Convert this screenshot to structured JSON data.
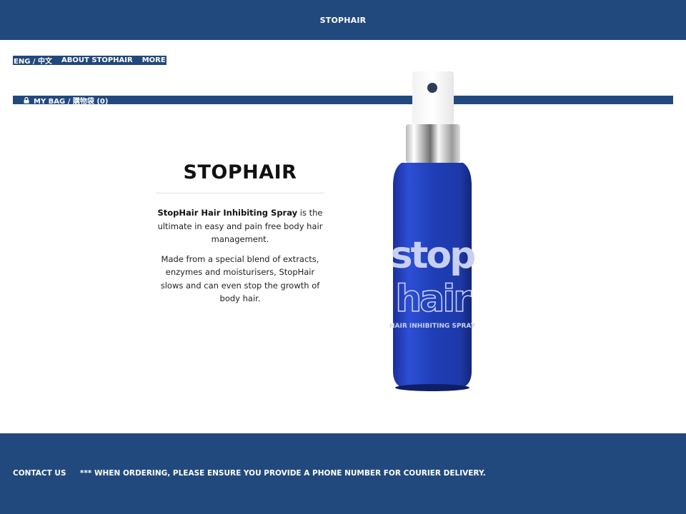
{
  "header": {
    "brand": "STOPHAIR"
  },
  "nav": {
    "language": "ENG / 中文",
    "about": "ABOUT STOPHAIR",
    "more": "MORE"
  },
  "bag": {
    "label": "MY BAG / 購物袋 (0)"
  },
  "product": {
    "title": "STOPHAIR",
    "desc1_bold": "StopHair Hair Inhibiting Spray",
    "desc1_rest": " is the ultimate in easy and pain free body hair management.",
    "desc2": "Made from a special blend of extracts, enzymes and moisturisers, StopHair slows and can even stop the growth of body hair.",
    "bottle_text_line1": "stop",
    "bottle_text_line2": "hair",
    "bottle_text_line3": "HAIR INHIBITING SPRAY"
  },
  "footer": {
    "contact": "CONTACT US",
    "notice": "*** WHEN ORDERING, PLEASE ENSURE YOU PROVIDE A PHONE NUMBER FOR COURIER DELIVERY."
  },
  "colors": {
    "brand_blue": "#22497d",
    "bottle_blue": "#1f3fb3"
  },
  "icons": {
    "bag": "lock-icon"
  }
}
